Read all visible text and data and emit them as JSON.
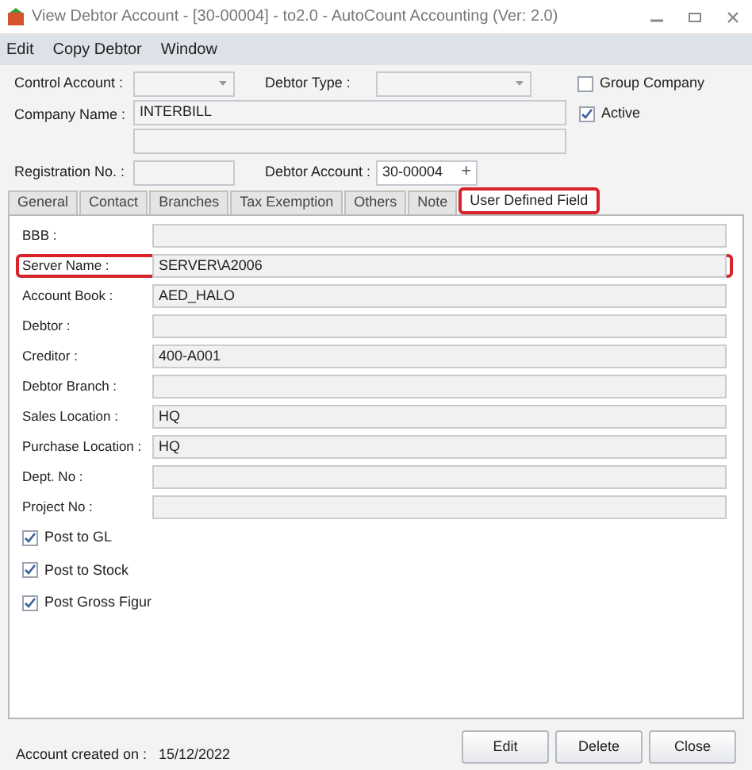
{
  "window": {
    "title": "View Debtor Account - [30-00004] - to2.0 - AutoCount Accounting (Ver: 2.0)"
  },
  "menu": [
    "Edit",
    "Copy Debtor",
    "Window"
  ],
  "header": {
    "control_account": {
      "label": "Control Account :"
    },
    "debtor_type": {
      "label": "Debtor Type :"
    },
    "group_company": {
      "label": "Group Company",
      "checked": false
    },
    "active": {
      "label": "Active",
      "checked": true
    },
    "company_name": {
      "label": "Company Name :",
      "value": "INTERBILL"
    },
    "registration_no": {
      "label": "Registration No. :"
    },
    "debtor_account": {
      "label": "Debtor Account :",
      "value": "30-00004",
      "button": "+"
    }
  },
  "tabs": [
    {
      "label": "General",
      "selected": false,
      "highlighted": false
    },
    {
      "label": "Contact",
      "selected": false,
      "highlighted": false
    },
    {
      "label": "Branches",
      "selected": false,
      "highlighted": false
    },
    {
      "label": "Tax Exemption",
      "selected": false,
      "highlighted": false
    },
    {
      "label": "Others",
      "selected": false,
      "highlighted": false
    },
    {
      "label": "Note",
      "selected": false,
      "highlighted": false
    },
    {
      "label": "User Defined Field",
      "selected": true,
      "highlighted": true
    }
  ],
  "fields": [
    {
      "label": "BBB :",
      "highlighted": false
    },
    {
      "label": "Server Name :",
      "value": "SERVER\\A2006",
      "highlighted": true
    },
    {
      "label": "Account Book :",
      "value": "AED_HALO",
      "highlighted": false
    },
    {
      "label": "Debtor :",
      "highlighted": false
    },
    {
      "label": "Creditor :",
      "value": "400-A001",
      "highlighted": false
    },
    {
      "label": "Debtor Branch :",
      "highlighted": false
    },
    {
      "label": "Sales Location :",
      "value": "HQ",
      "highlighted": false
    },
    {
      "label": "Purchase Location :",
      "value": "HQ",
      "highlighted": false
    },
    {
      "label": "Dept. No :",
      "highlighted": false
    },
    {
      "label": "Project No :",
      "highlighted": false
    }
  ],
  "options": [
    {
      "label": "Post to GL",
      "checked": true
    },
    {
      "label": "Post to Stock",
      "checked": true
    },
    {
      "label": "Post Gross Figur",
      "checked": true
    }
  ],
  "footer": {
    "label": "Account created on :",
    "value": "15/12/2022"
  },
  "buttons": [
    "Edit",
    "Delete",
    "Close"
  ]
}
